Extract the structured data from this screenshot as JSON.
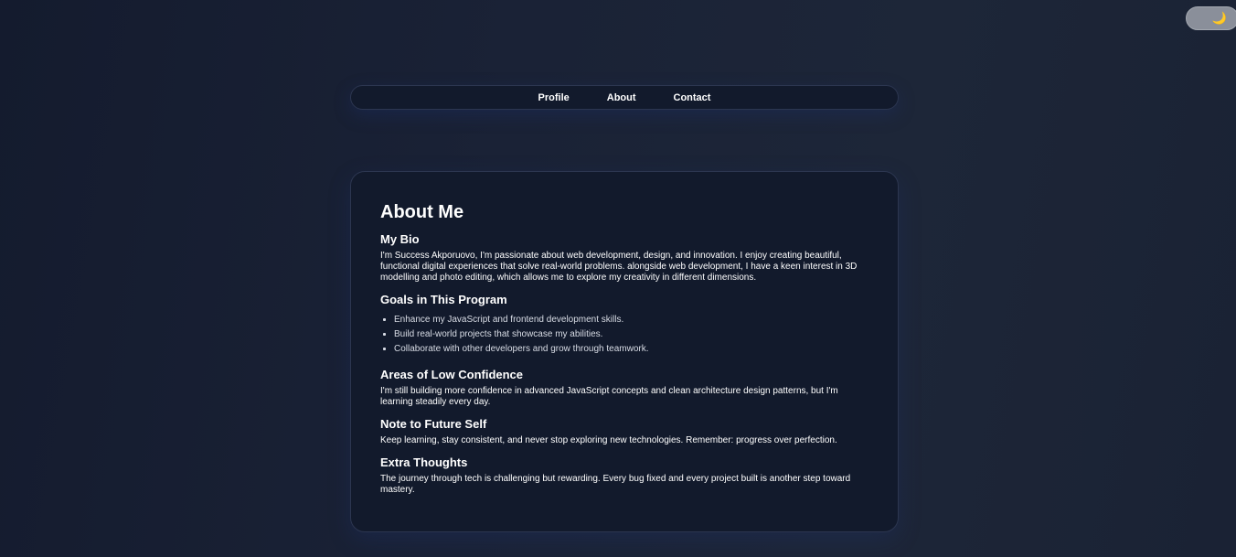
{
  "theme_toggle": {
    "icon": "moon-icon",
    "glyph": "🌙",
    "color": "#f5c542"
  },
  "nav": {
    "links": [
      "Profile",
      "About",
      "Contact"
    ]
  },
  "about": {
    "title": "About Me",
    "bio": {
      "heading": "My Bio",
      "text": "I'm Success Akporuovo, I'm passionate about web development, design, and innovation. I enjoy creating beautiful, functional digital experiences that solve real-world problems. alongside web development, I have a keen interest in 3D modelling and photo editing, which allows me to explore my creativity in different dimensions."
    },
    "goals": {
      "heading": "Goals in This Program",
      "items": [
        "Enhance my JavaScript and frontend development skills.",
        "Build real-world projects that showcase my abilities.",
        "Collaborate with other developers and grow through teamwork."
      ]
    },
    "low_confidence": {
      "heading": "Areas of Low Confidence",
      "text": "I'm still building more confidence in advanced JavaScript concepts and clean architecture design patterns, but I'm learning steadily every day."
    },
    "future_self": {
      "heading": "Note to Future Self",
      "text": "Keep learning, stay consistent, and never stop exploring new technologies. Remember: progress over perfection."
    },
    "extra": {
      "heading": "Extra Thoughts",
      "text": "The journey through tech is challenging but rewarding. Every bug fixed and every project built is another step toward mastery."
    }
  },
  "colors": {
    "background": "#1a2236",
    "card": "#121a2c",
    "border": "#2c3650",
    "text": "#ffffff",
    "toggle": "#8a8f9a"
  }
}
